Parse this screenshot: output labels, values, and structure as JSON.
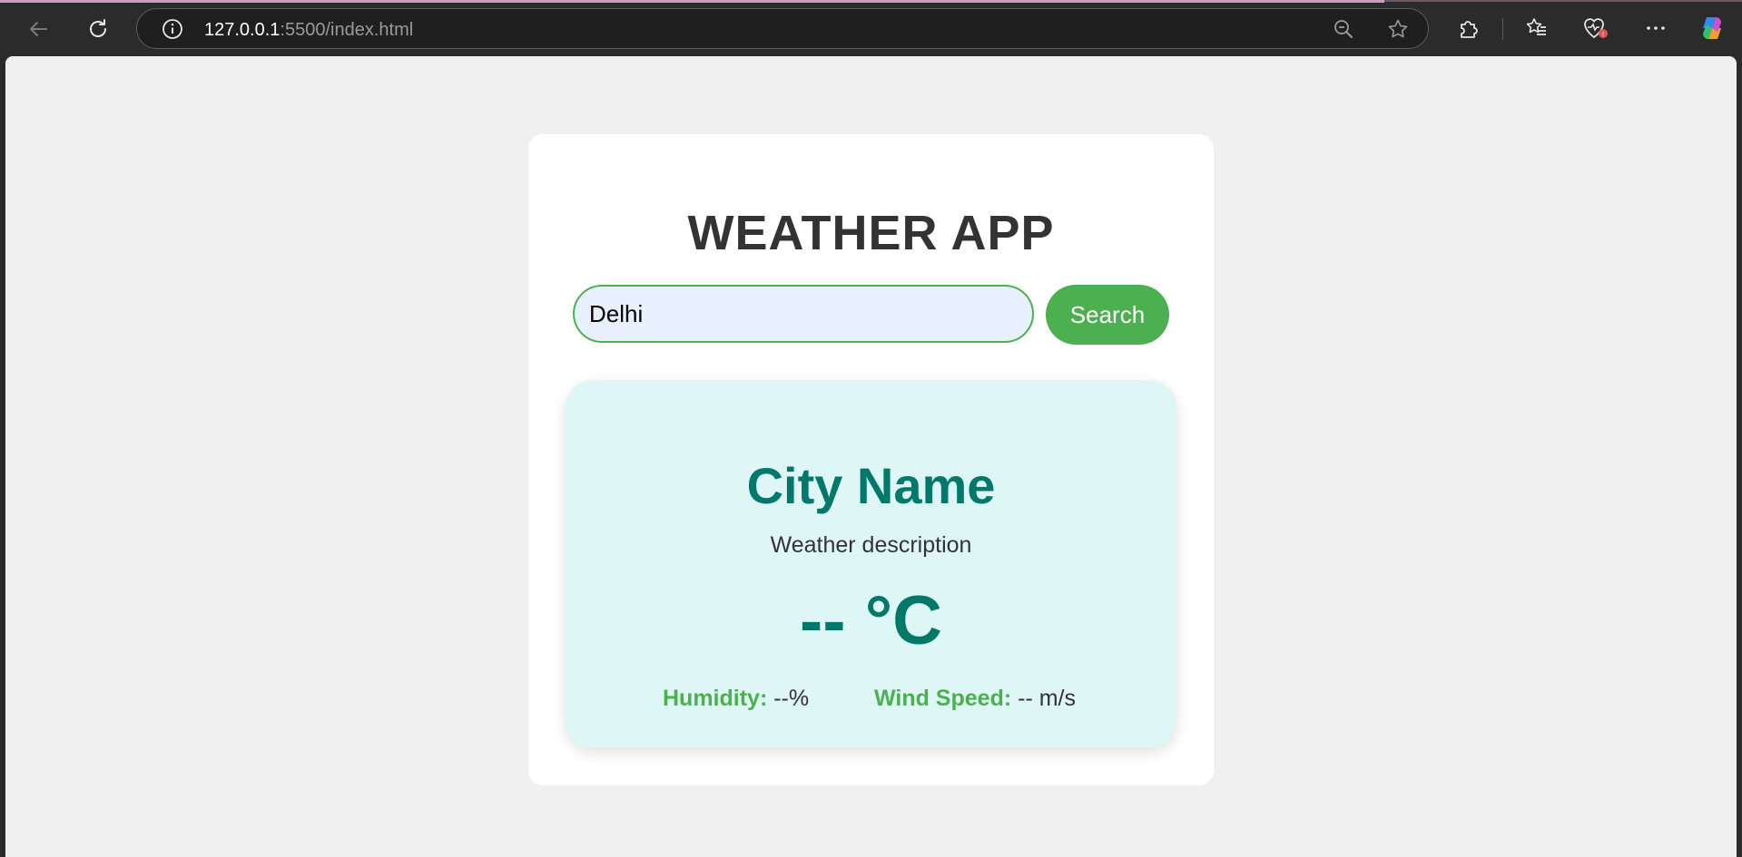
{
  "browser": {
    "url_host": "127.0.0.1",
    "url_rest": ":5500/index.html"
  },
  "app": {
    "title": "WEATHER APP",
    "search": {
      "value": "Delhi",
      "button_label": "Search"
    },
    "weather": {
      "city": "City Name",
      "description": "Weather description",
      "temperature": "-- °C",
      "humidity_label": "Humidity:",
      "humidity_value": "--%",
      "wind_label": "Wind Speed:",
      "wind_value": "-- m/s"
    }
  },
  "colors": {
    "accent_green": "#4caf50",
    "teal": "#00796b",
    "card_bg": "#dff6f7",
    "page_bg": "#f0f0f0"
  },
  "icons": [
    "back-arrow-icon",
    "refresh-icon",
    "info-icon",
    "zoom-out-icon",
    "favorite-star-icon",
    "extensions-icon",
    "favorites-icon",
    "browser-essentials-icon",
    "more-icon",
    "copilot-icon"
  ]
}
